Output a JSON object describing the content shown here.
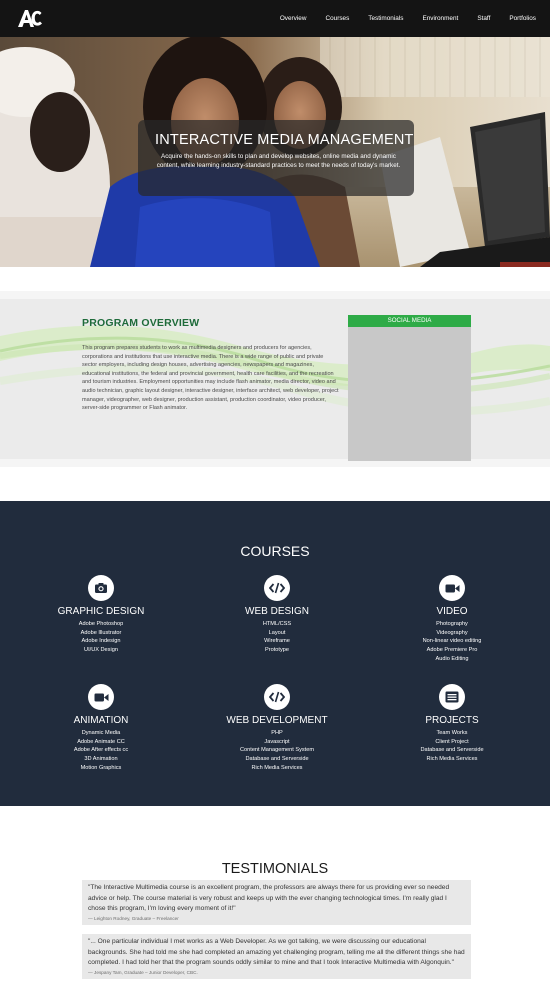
{
  "nav": {
    "logo_text": "AC",
    "links": [
      "Overview",
      "Courses",
      "Testimonials",
      "Environment",
      "Staff",
      "Portfolios"
    ]
  },
  "hero": {
    "title": "INTERACTIVE MEDIA MANAGEMENT",
    "subtitle": "Acquire the hands-on skills to plan and develop websites, online media and dynamic content, while learning industry-standard practices to meet the needs of today's market."
  },
  "overview": {
    "title": "PROGRAM OVERVIEW",
    "body": "This program prepares students to work as multimedia designers and producers for agencies, corporations and institutions that use interactive media. There is a wide range of public and private sector employers, including design houses, advertising agencies, newspapers and magazines, educational institutions, the federal and provincial government, health care facilities, and the recreation and tourism industries. Employment opportunities may include flash animator, media director, video and audio technician, graphic layout designer, interactive designer, interface architect, web developer, project manager, videographer, web designer, production assistant, production coordinator, video producer, server-side programmer or Flash animator.",
    "social_title": "SOCIAL MEDIA"
  },
  "courses": {
    "title": "COURSES",
    "items": [
      {
        "name": "GRAPHIC DESIGN",
        "icon": "camera-icon",
        "items": [
          "Adobe Photoshop",
          "Adobe Illustrator",
          "Adobe Indesign",
          "UI/UX Design"
        ]
      },
      {
        "name": "WEB DESIGN",
        "icon": "code-icon",
        "items": [
          "HTML/CSS",
          "Layout",
          "Wireframe",
          "Prototype"
        ]
      },
      {
        "name": "VIDEO",
        "icon": "video-camera-icon",
        "items": [
          "Photography",
          "Videography",
          "Non-linear video editing",
          "Adobe Premiere Pro",
          "Audio Editing"
        ]
      },
      {
        "name": "ANIMATION",
        "icon": "video-camera-icon",
        "items": [
          "Dynamic Media",
          "Adobe Animate CC",
          "Adobe After effects cc",
          "3D Animation",
          "Motion Graphics"
        ]
      },
      {
        "name": "WEB DEVELOPMENT",
        "icon": "code-icon",
        "items": [
          "PHP",
          "Javascript",
          "Content Management System",
          "Database and Serverside",
          "Rich Media Services"
        ]
      },
      {
        "name": "PROJECTS",
        "icon": "list-icon",
        "items": [
          "Team Works",
          "Client Project",
          "Database and Serverside",
          "Rich Media Services"
        ]
      }
    ]
  },
  "testimonials": {
    "title": "TESTIMONIALS",
    "quotes": [
      {
        "text": "\"The Interactive Multimedia course is an excellent program, the professors are always there for us providing ever so needed advice or help. The course material is very robust and keeps up with the ever changing technological times. I'm really glad I chose this program, I'm loving every moment of it!\"",
        "author": "— Leighton Rodney, Graduate – Freelancer"
      },
      {
        "text": "\"... One particular individual I met works as a Web Developer. As we got talking, we were discussing our educational backgrounds. She had told me she had completed an amazing yet challenging program, telling me all the different things she had completed. I had told her that the program sounds oddly similar to mine and that I took Interactive Multimedia with Algonquin.\"",
        "author": "— Jespany Tam, Graduate – Junior Developer, CBC."
      }
    ]
  },
  "colors": {
    "nav_bg": "#141414",
    "overview_heading": "#1e6b3a",
    "social_header": "#2eab47",
    "courses_bg": "#212c3d"
  }
}
